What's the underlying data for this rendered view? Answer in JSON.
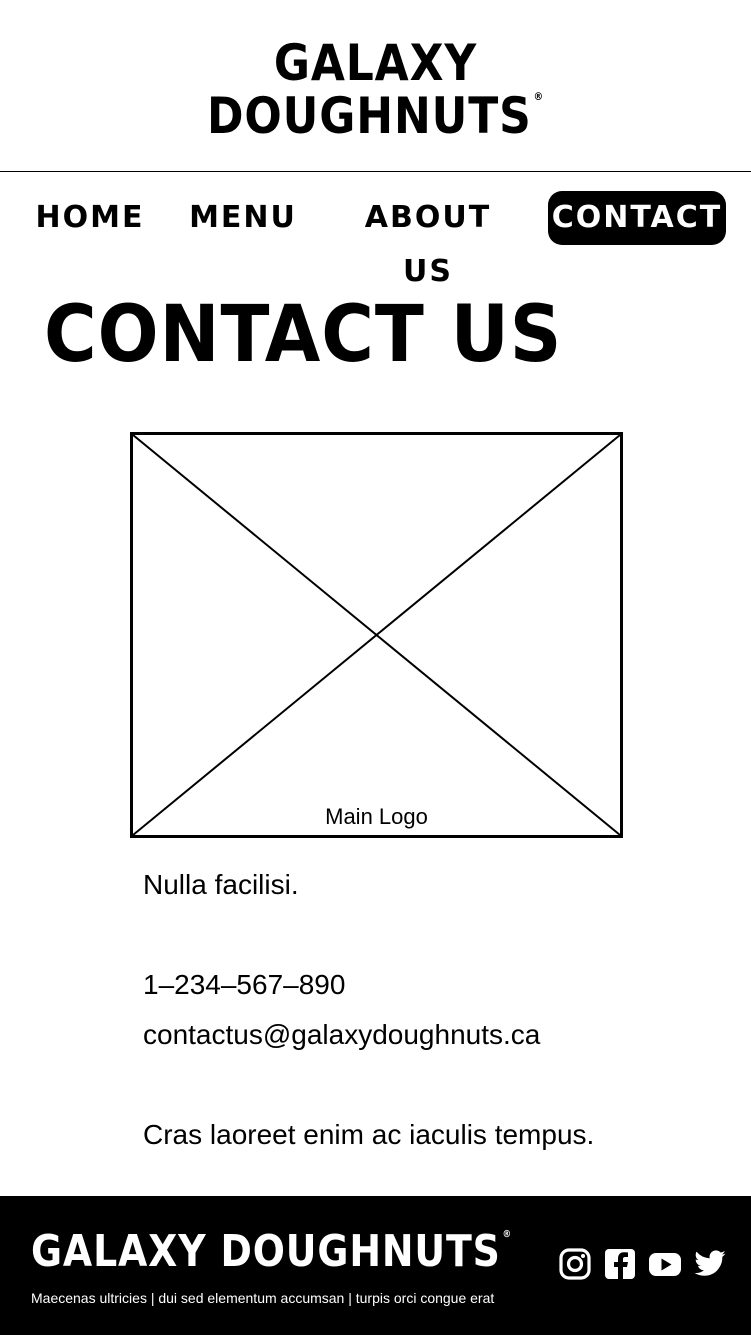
{
  "header": {
    "brand_line1": "GALAXY",
    "brand_line2": "DOUGHNUTS",
    "registered_mark": "®"
  },
  "nav": {
    "items": [
      {
        "label": "HOME",
        "active": false
      },
      {
        "label": "MENU",
        "active": false
      },
      {
        "label": "ABOUT US",
        "active": false
      },
      {
        "label": "CONTACT",
        "active": true
      }
    ]
  },
  "page": {
    "title": "CONTACT US",
    "image_caption": "Main Logo",
    "intro": "Nulla facilisi.",
    "phone": "1–234–567–890",
    "email": "contactus@galaxydoughnuts.ca",
    "closing": "Cras laoreet enim ac iaculis tempus."
  },
  "footer": {
    "brand": "GALAXY DOUGHNUTS",
    "registered_mark": "®",
    "tagline": "Maecenas ultricies | dui sed elementum accumsan | turpis orci congue erat",
    "social_icons": [
      "instagram-icon",
      "facebook-icon",
      "youtube-icon",
      "twitter-icon"
    ]
  },
  "colors": {
    "background": "#ffffff",
    "foreground": "#000000",
    "footer_background": "#000000",
    "footer_text": "#ffffff"
  }
}
